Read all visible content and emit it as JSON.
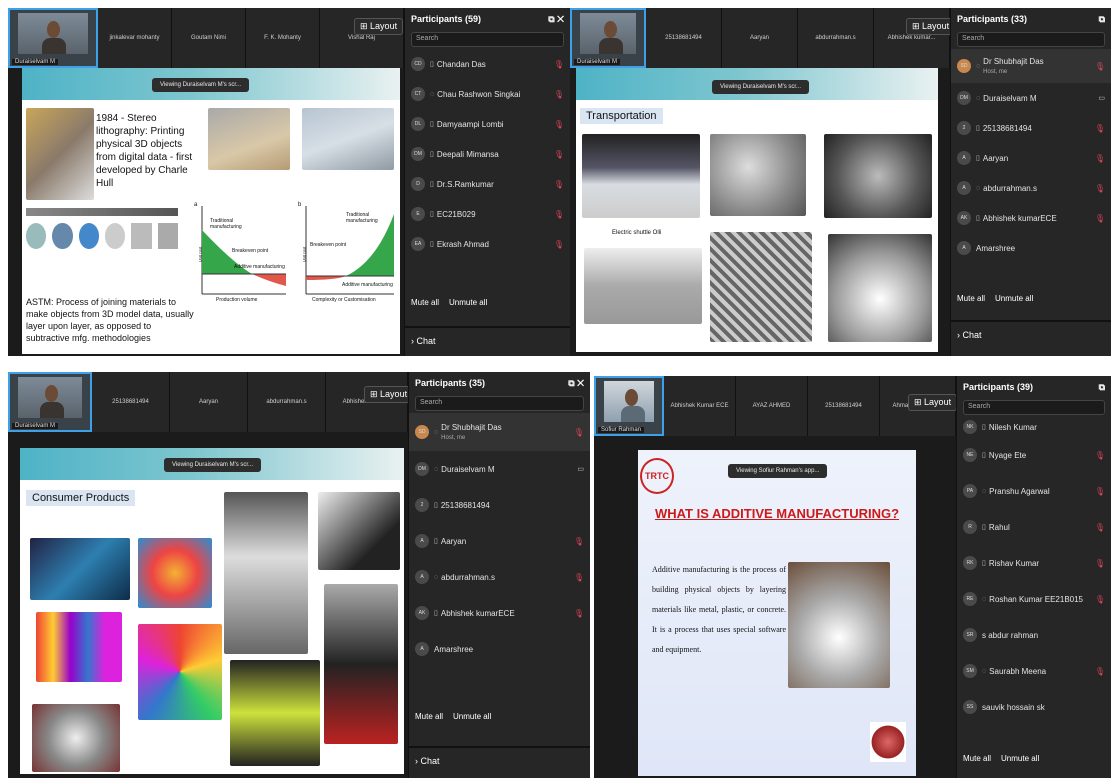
{
  "q1": {
    "tiles": [
      "jinkalevar mohanty",
      "Goutam Nimi",
      "F. K. Mohanty",
      "Vishal Raj"
    ],
    "self_name": "Duraiselvam M",
    "layout": "Layout",
    "viewing": "Viewing Duraiselvam M's scr...",
    "slide": {
      "stereo": "1984 - Stereo lithography: Printing physical 3D objects from digital data - first developed by Charle Hull",
      "astm": "ASTM: Process of joining materials to make objects from 3D model data, usually layer upon layer, as opposed to subtractive mfg. methodologies",
      "chart_a": {
        "label": "a",
        "trad": "Traditional manufacturing",
        "breakeven": "Breakeven point",
        "additive": "Additive manufacturing",
        "xlabel": "Production volume",
        "ylabel": "Unit cost"
      },
      "chart_b": {
        "label": "b",
        "trad": "Traditional manufacturing",
        "breakeven": "Breakeven point",
        "additive": "Additive manufacturing",
        "xlabel": "Complexity or Customisation",
        "ylabel": "Unit cost"
      }
    },
    "panel": {
      "title": "Participants (59)",
      "search": "Search",
      "rows": [
        {
          "init": "CD",
          "name": "Chandan Das"
        },
        {
          "init": "CT",
          "name": "Chau Rashwon Singkai"
        },
        {
          "init": "DL",
          "name": "Damyaampi Lombi"
        },
        {
          "init": "DM",
          "name": "Deepali Mimansa"
        },
        {
          "init": "D",
          "name": "Dr.S.Ramkumar"
        },
        {
          "init": "E",
          "name": "EC21B029"
        },
        {
          "init": "EA",
          "name": "Ekrash Ahmad"
        }
      ],
      "mute_all": "Mute all",
      "unmute_all": "Unmute all",
      "chat": "Chat"
    }
  },
  "q2": {
    "tiles": [
      "25138681494",
      "Aaryan",
      "abdurrahman.s",
      "Abhishek kumar..."
    ],
    "self_name": "Duraiselvam M",
    "layout": "Layout",
    "viewing": "Viewing Duraiselvam M's scr...",
    "slide_title": "Transportation",
    "caption": "Electric shuttle Olli",
    "panel": {
      "title": "Participants (33)",
      "search": "Search",
      "rows": [
        {
          "init": "SD",
          "name": "Dr Shubhajit Das",
          "sub": "Host, me"
        },
        {
          "init": "DM",
          "name": "Duraiselvam M"
        },
        {
          "init": "2",
          "name": "25138681494"
        },
        {
          "init": "A",
          "name": "Aaryan"
        },
        {
          "init": "A",
          "name": "abdurrahman.s"
        },
        {
          "init": "AK",
          "name": "Abhishek kumarECE"
        },
        {
          "init": "A",
          "name": "Amarshree"
        }
      ],
      "mute_all": "Mute all",
      "unmute_all": "Unmute all",
      "chat": "Chat"
    }
  },
  "q3": {
    "tiles": [
      "25138681494",
      "Aaryan",
      "abdurrahman.s",
      "Abhishek kumar..."
    ],
    "self_name": "Duraiselvam M",
    "layout": "Layout",
    "viewing": "Viewing Duraiselvam M's scr...",
    "slide_title": "Consumer Products",
    "panel": {
      "title": "Participants (35)",
      "search": "Search",
      "rows": [
        {
          "init": "SD",
          "name": "Dr Shubhajit Das",
          "sub": "Host, me"
        },
        {
          "init": "DM",
          "name": "Duraiselvam M"
        },
        {
          "init": "2",
          "name": "25138681494"
        },
        {
          "init": "A",
          "name": "Aaryan"
        },
        {
          "init": "A",
          "name": "abdurrahman.s"
        },
        {
          "init": "AK",
          "name": "Abhishek kumarECE"
        },
        {
          "init": "A",
          "name": "Amarshree"
        }
      ],
      "mute_all": "Mute all",
      "unmute_all": "Unmute all",
      "chat": "Chat"
    }
  },
  "q4": {
    "tiles": [
      "Abhishek Kumar ECE",
      "AYAZ AHMED",
      "25138681494",
      "Ahmad Sohail Aziz"
    ],
    "self_name": "Sofiur Rahman",
    "layout": "Layout",
    "viewing": "Viewing Sofiur Rahman's app...",
    "logo": "TRTC",
    "slide_title": "WHAT IS ADDITIVE MANUFACTURING?",
    "body": "Additive manufacturing is the process of building physical objects by layering materials like metal, plastic, or concrete. It is a process that uses special software and equipment.",
    "panel": {
      "title": "Participants (39)",
      "search": "Search",
      "rows": [
        {
          "init": "NK",
          "name": "Nilesh Kumar"
        },
        {
          "init": "NE",
          "name": "Nyage Ete"
        },
        {
          "init": "PA",
          "name": "Pranshu Agarwal"
        },
        {
          "init": "R",
          "name": "Rahul"
        },
        {
          "init": "RK",
          "name": "Rishav Kumar"
        },
        {
          "init": "RE",
          "name": "Roshan Kumar EE21B015"
        },
        {
          "init": "SR",
          "name": "s abdur rahman"
        },
        {
          "init": "SM",
          "name": "Saurabh Meena"
        },
        {
          "init": "SS",
          "name": "sauvik hossain sk"
        }
      ],
      "mute_all": "Mute all",
      "unmute_all": "Unmute all"
    }
  },
  "colors": {
    "accent": "#3ea0e6",
    "muted_mic": "#e0465a",
    "panel": "#262626",
    "banner": "#4eb3c6",
    "am_title": "#cc1a1a"
  }
}
